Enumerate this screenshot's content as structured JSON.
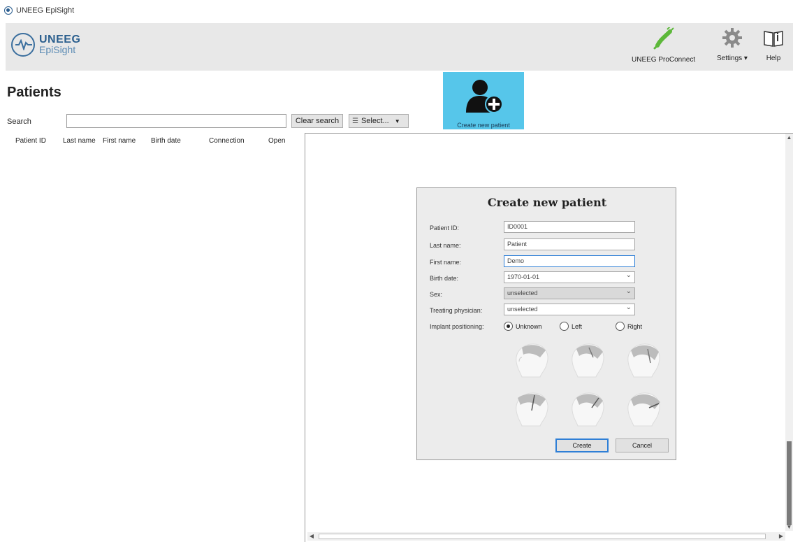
{
  "window": {
    "title": "UNEEG EpiSight"
  },
  "header": {
    "logo_line1": "UNEEG",
    "logo_line2": "EpiSight",
    "proconnect_label": "UNEEG ProConnect",
    "settings_label": "Settings",
    "help_label": "Help"
  },
  "patients": {
    "title": "Patients",
    "search_label": "Search",
    "search_value": "",
    "clear_search_label": "Clear search",
    "select_label": "Select...",
    "create_new_patient_label": "Create new patient",
    "columns": [
      "Patient ID",
      "Last name",
      "First name",
      "Birth date",
      "Connection",
      "Open"
    ]
  },
  "dialog": {
    "title": "Create new patient",
    "fields": {
      "patient_id": {
        "label": "Patient ID:",
        "value": "ID0001"
      },
      "last_name": {
        "label": "Last name:",
        "value": "Patient"
      },
      "first_name": {
        "label": "First name:",
        "value": "Demo"
      },
      "birth_date": {
        "label": "Birth date:",
        "value": "1970-01-01"
      },
      "sex": {
        "label": "Sex:",
        "value": "unselected"
      },
      "physician": {
        "label": "Treating physician:",
        "value": "unselected"
      }
    },
    "implant": {
      "label": "Implant positioning:",
      "options": [
        "Unknown",
        "Left",
        "Right"
      ],
      "selected": "Unknown"
    },
    "create_label": "Create",
    "cancel_label": "Cancel"
  },
  "colors": {
    "accent_tile": "#56c6ea",
    "brand": "#2b5f8e",
    "plug_green": "#5db83a"
  }
}
